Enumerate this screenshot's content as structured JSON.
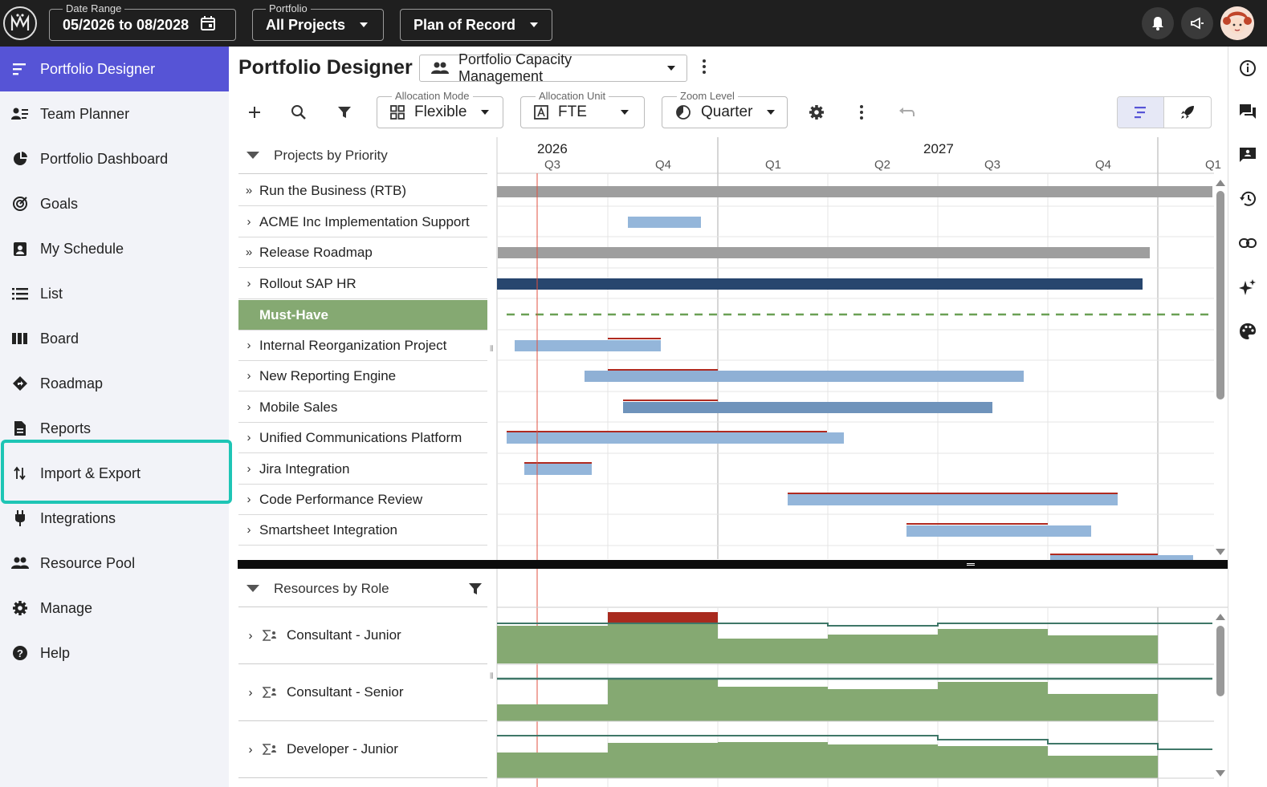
{
  "topbar": {
    "date_range_legend": "Date Range",
    "date_range_value": "05/2026 to 08/2028",
    "portfolio_legend": "Portfolio",
    "portfolio_value": "All Projects",
    "scenario_value": "Plan of Record"
  },
  "sidebar": {
    "items": [
      {
        "label": "Portfolio Designer",
        "icon": "gantt-icon"
      },
      {
        "label": "Team Planner",
        "icon": "team-planner-icon"
      },
      {
        "label": "Portfolio Dashboard",
        "icon": "dashboard-icon"
      },
      {
        "label": "Goals",
        "icon": "target-icon"
      },
      {
        "label": "My Schedule",
        "icon": "schedule-icon"
      },
      {
        "label": "List",
        "icon": "list-icon"
      },
      {
        "label": "Board",
        "icon": "board-icon"
      },
      {
        "label": "Roadmap",
        "icon": "roadmap-icon"
      },
      {
        "label": "Reports",
        "icon": "report-icon"
      },
      {
        "label": "Import & Export",
        "icon": "import-export-icon"
      },
      {
        "label": "Integrations",
        "icon": "plug-icon"
      },
      {
        "label": "Resource Pool",
        "icon": "people-icon"
      },
      {
        "label": "Manage",
        "icon": "gear-icon"
      },
      {
        "label": "Help",
        "icon": "help-icon"
      }
    ]
  },
  "header": {
    "title": "Portfolio Designer",
    "view_select": "Portfolio Capacity Management"
  },
  "toolbar": {
    "allocation_mode_legend": "Allocation Mode",
    "allocation_mode_value": "Flexible",
    "allocation_unit_legend": "Allocation Unit",
    "allocation_unit_value": "FTE",
    "zoom_level_legend": "Zoom Level",
    "zoom_level_value": "Quarter"
  },
  "timeline": {
    "years": [
      "2026",
      "2027"
    ],
    "quarters": [
      "Q3",
      "Q4",
      "Q1",
      "Q2",
      "Q3",
      "Q4",
      "Q1"
    ]
  },
  "projects": {
    "header": "Projects by Priority",
    "rows": [
      {
        "label": "Run the Business (RTB)",
        "chevron": "»"
      },
      {
        "label": "ACME Inc Implementation Support",
        "chevron": "›"
      },
      {
        "label": "Release Roadmap",
        "chevron": "»"
      },
      {
        "label": "Rollout SAP HR",
        "chevron": "›"
      },
      {
        "label": "Must-Have",
        "chevron": ""
      },
      {
        "label": "Internal Reorganization Project",
        "chevron": "›"
      },
      {
        "label": "New Reporting Engine",
        "chevron": "›"
      },
      {
        "label": "Mobile Sales",
        "chevron": "›"
      },
      {
        "label": "Unified Communications Platform",
        "chevron": "›"
      },
      {
        "label": "Jira Integration",
        "chevron": "›"
      },
      {
        "label": "Code Performance Review",
        "chevron": "›"
      },
      {
        "label": "Smartsheet Integration",
        "chevron": "›"
      }
    ]
  },
  "resources": {
    "header": "Resources by Role",
    "rows": [
      {
        "label": "Consultant - Junior"
      },
      {
        "label": "Consultant - Senior"
      },
      {
        "label": "Developer - Junior"
      }
    ]
  },
  "colors": {
    "accent": "#5654d6",
    "highlight": "#1ec5b5",
    "must_have": "#85a972",
    "bar_light": "#94b6da",
    "bar_mid": "#6f93bb",
    "bar_dark": "#27466e",
    "bar_gray": "#9e9e9e",
    "overalloc": "#b02a20",
    "today_line": "#e05040"
  }
}
